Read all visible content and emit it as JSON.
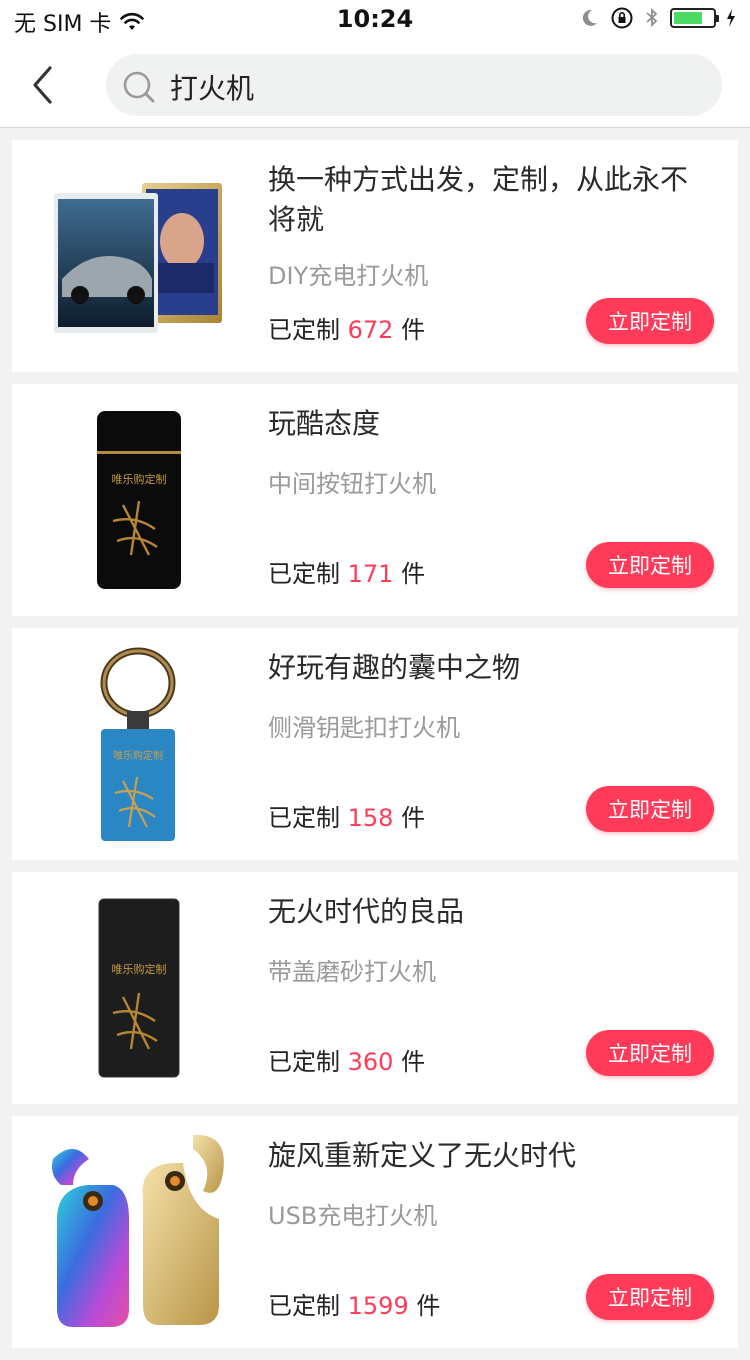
{
  "status_bar": {
    "carrier": "无 SIM 卡",
    "time": "10:24"
  },
  "search": {
    "query": "打火机"
  },
  "colors": {
    "accent": "#ff3b59",
    "battery": "#4cd964"
  },
  "products": [
    {
      "title": "换一种方式出发，定制，从此永不将就",
      "subtitle": "DIY充电打火机",
      "count_prefix": "已定制",
      "count": "672",
      "count_suffix": "件",
      "button": "立即定制",
      "image": "car-photo-lighters"
    },
    {
      "title": "玩酷态度",
      "subtitle": "中间按钮打火机",
      "count_prefix": "已定制",
      "count": "171",
      "count_suffix": "件",
      "button": "立即定制",
      "image": "black-lighter",
      "image_text": "唯乐购定制"
    },
    {
      "title": "好玩有趣的囊中之物",
      "subtitle": "侧滑钥匙扣打火机",
      "count_prefix": "已定制",
      "count": "158",
      "count_suffix": "件",
      "button": "立即定制",
      "image": "blue-keychain-lighter",
      "image_text": "唯乐购定制"
    },
    {
      "title": "无火时代的良品",
      "subtitle": "带盖磨砂打火机",
      "count_prefix": "已定制",
      "count": "360",
      "count_suffix": "件",
      "button": "立即定制",
      "image": "matte-black-lighter",
      "image_text": "唯乐购定制"
    },
    {
      "title": "旋风重新定义了无火时代",
      "subtitle": "USB充电打火机",
      "count_prefix": "已定制",
      "count": "1599",
      "count_suffix": "件",
      "button": "立即定制",
      "image": "usb-lighters"
    }
  ]
}
